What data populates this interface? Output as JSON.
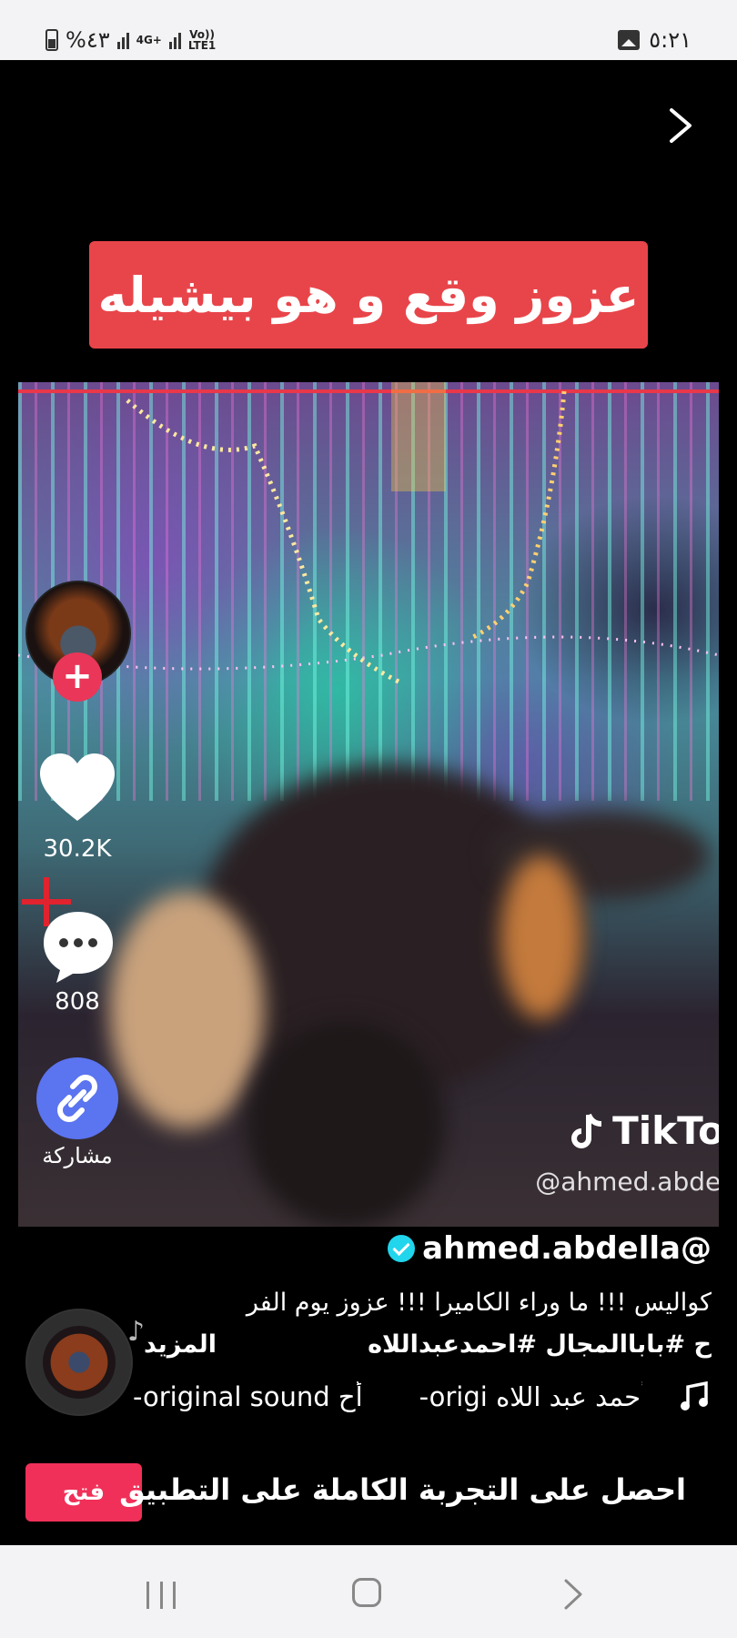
{
  "status_bar": {
    "battery_percent": "%٤٣",
    "network_4g": "4G+",
    "network_volte_top": "Vo))",
    "network_volte_bottom": "LTE1",
    "time": "٥:٢١"
  },
  "video": {
    "title_banner": "عزوز وقع و هو بيشيله",
    "watermark_brand": "TikTo",
    "watermark_handle": "@ahmed.abdel"
  },
  "actions": {
    "likes": "30.2K",
    "comments": "808",
    "share_label": "مشاركة",
    "follow_symbol": "+"
  },
  "caption": {
    "username": "ahmed.abdella@",
    "line1": "كواليس !!! ما وراء الكاميرا !!! عزوز يوم الفر",
    "line2": "ح #باباالمجال #احمدعبداللاه",
    "more": "المزيد",
    "music_part1": "-original sound أح",
    "music_part2": "-origi أحمد عبد اللاه"
  },
  "bottom_banner": {
    "open_button": "فتح",
    "promo_text": "احصل على التجربة الكاملة على التطبيق"
  },
  "colors": {
    "banner_red": "#e8454a",
    "follow_red": "#ea3658",
    "open_red": "#f03058",
    "share_blue": "#5b74f0",
    "verified_cyan": "#20d5ec"
  }
}
